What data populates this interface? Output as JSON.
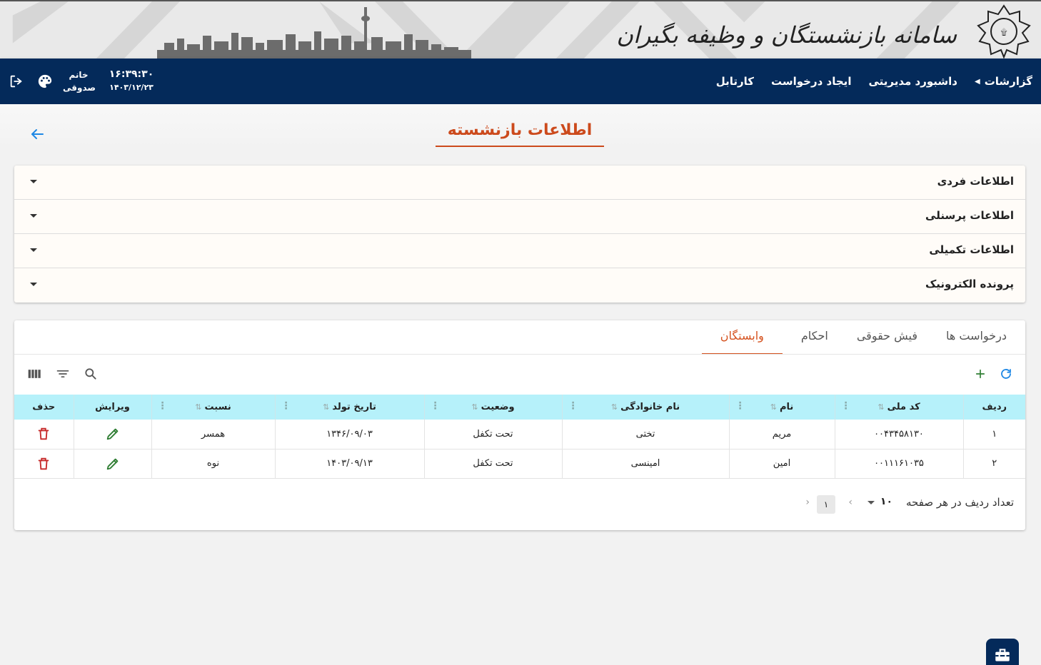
{
  "banner": {
    "title": "سامانه بازنشستگان و وظیفه بگیران"
  },
  "nav": {
    "items": [
      {
        "label": "کارتابل"
      },
      {
        "label": "ایجاد درخواست"
      },
      {
        "label": "داشبورد مدیریتی"
      },
      {
        "label": "گزارشات"
      }
    ],
    "user": {
      "line1": "خانم",
      "line2": "صدوقی"
    },
    "time": "۱۶:۳۹:۳۰",
    "date": "۱۴۰۳/۱۲/۲۳"
  },
  "page": {
    "title": "اطلاعات بازنشسته"
  },
  "accordion": [
    {
      "label": "اطلاعات فردی"
    },
    {
      "label": "اطلاعات پرسنلی"
    },
    {
      "label": "اطلاعات تکمیلی"
    },
    {
      "label": "پرونده الکترونیک"
    }
  ],
  "tabs": [
    {
      "label": "وابستگان",
      "active": true
    },
    {
      "label": "احکام"
    },
    {
      "label": "فیش حقوقی"
    },
    {
      "label": "درخواست ها"
    }
  ],
  "table": {
    "columns": [
      "ردیف",
      "کد ملی",
      "نام",
      "نام خانوادگی",
      "وضعیت",
      "تاریخ تولد",
      "نسبت",
      "ویرایش",
      "حذف"
    ],
    "rows": [
      {
        "index": "۱",
        "national_code": "۰۰۴۳۴۵۸۱۳۰",
        "first_name": "مریم",
        "last_name": "تختی",
        "status": "تحت تکفل",
        "birth_date": "۱۳۴۶/۰۹/۰۳",
        "relation": "همسر"
      },
      {
        "index": "۲",
        "national_code": "۰۰۱۱۱۶۱۰۳۵",
        "first_name": "امین",
        "last_name": "امینسی",
        "status": "تحت تکفل",
        "birth_date": "۱۴۰۳/۰۹/۱۳",
        "relation": "نوه"
      }
    ]
  },
  "pager": {
    "label": "تعداد ردیف در هر صفحه",
    "page_size": "۱۰",
    "current_page": "۱"
  },
  "colors": {
    "navbar": "#042a5a",
    "accent": "#d5521f",
    "header_row": "#b6f1fa",
    "edit_icon": "#2e7d32",
    "delete_icon": "#c62828",
    "toolbar_add": "#2e7d32",
    "toolbar_refresh": "#1e88e5"
  },
  "icons": [
    "logo-icon",
    "logout-icon",
    "palette-icon",
    "back-arrow-icon",
    "refresh-icon",
    "add-icon",
    "search-icon",
    "filter-icon",
    "columns-icon",
    "edit-icon",
    "delete-icon",
    "toolbox-icon"
  ]
}
